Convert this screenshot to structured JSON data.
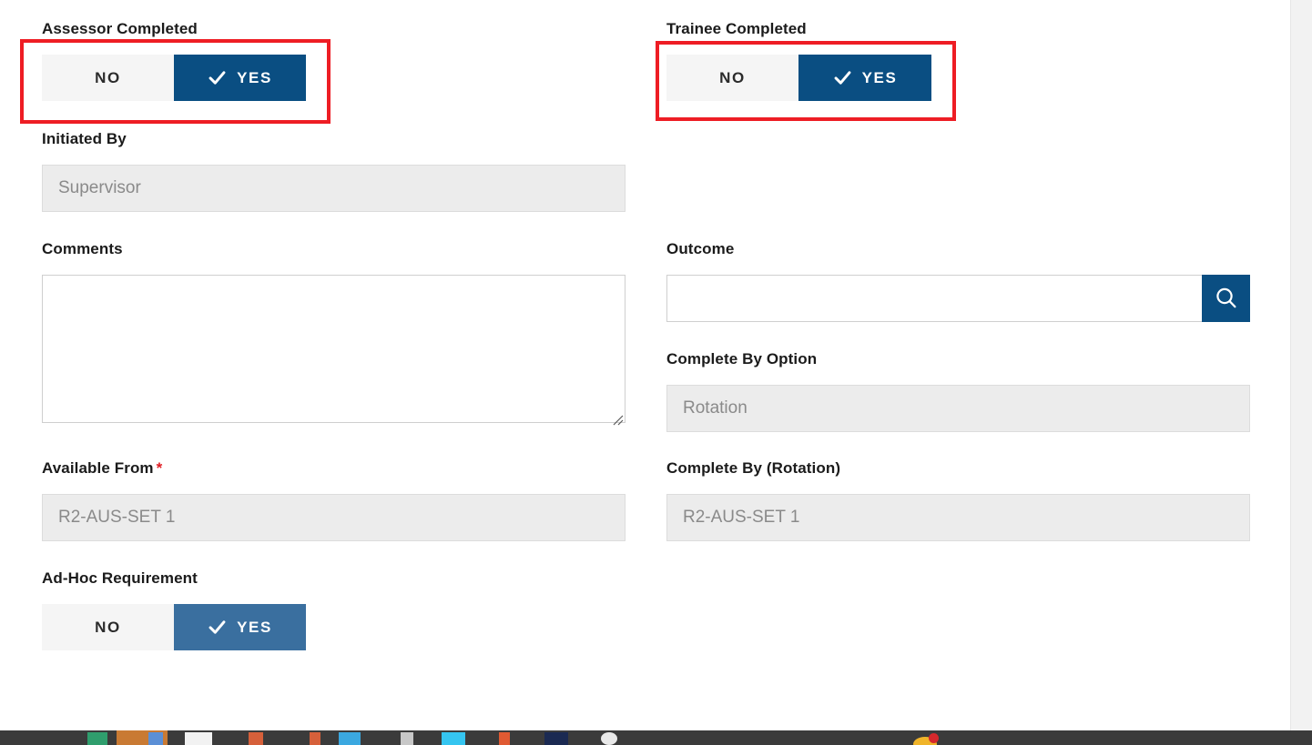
{
  "form": {
    "left_column": [
      {
        "key": "assessor_completed",
        "label": "Assessor Completed",
        "type": "toggle",
        "options": [
          "NO",
          "YES"
        ],
        "selected": "YES",
        "highlighted": true
      },
      {
        "key": "initiated_by",
        "label": "Initiated By",
        "type": "text",
        "value": "Supervisor",
        "disabled": true
      },
      {
        "key": "comments",
        "label": "Comments",
        "type": "textarea",
        "value": "",
        "placeholder": ""
      },
      {
        "key": "available_from",
        "label": "Available From",
        "required": true,
        "required_marker": "*",
        "type": "text",
        "value": "R2-AUS-SET 1",
        "disabled": true
      },
      {
        "key": "ad_hoc_requirement",
        "label": "Ad-Hoc Requirement",
        "type": "toggle",
        "options": [
          "NO",
          "YES"
        ],
        "selected": "YES",
        "muted": true,
        "highlighted": false
      }
    ],
    "right_column": [
      {
        "key": "trainee_completed",
        "label": "Trainee Completed",
        "type": "toggle",
        "options": [
          "NO",
          "YES"
        ],
        "selected": "YES",
        "highlighted": true
      },
      {
        "key": "outcome",
        "label": "Outcome",
        "type": "search",
        "value": "",
        "placeholder": "",
        "button_icon": "search-icon"
      },
      {
        "key": "complete_by_option",
        "label": "Complete By Option",
        "type": "text",
        "value": "Rotation",
        "disabled": true
      },
      {
        "key": "complete_by_rotation",
        "label": "Complete By (Rotation)",
        "type": "text",
        "value": "R2-AUS-SET 1",
        "disabled": true
      }
    ]
  },
  "icons": {
    "check": "check-icon",
    "search": "search-icon",
    "resize_grip": "resize-grip-icon"
  },
  "colors": {
    "primary_blue": "#0a4e82",
    "muted_blue": "#3a6f9f",
    "toggle_off_bg": "#f5f5f5",
    "disabled_input_bg": "#ececec",
    "highlight_red": "#ee1d24",
    "required_red": "#e01b22",
    "label_text": "#1b1b1b",
    "disabled_text": "#8a8a8a",
    "taskbar_bg": "#3b3b3b"
  },
  "labels": {
    "assessor_completed": "Assessor Completed",
    "trainee_completed": "Trainee Completed",
    "initiated_by": "Initiated By",
    "comments": "Comments",
    "outcome": "Outcome",
    "complete_by_option": "Complete By Option",
    "available_from": "Available From",
    "complete_by_rotation": "Complete By (Rotation)",
    "ad_hoc_requirement": "Ad-Hoc Requirement"
  },
  "values": {
    "initiated_by": "Supervisor",
    "comments": "",
    "outcome": "",
    "complete_by_option": "Rotation",
    "available_from": "R2-AUS-SET 1",
    "complete_by_rotation": "R2-AUS-SET 1"
  },
  "toggle_labels": {
    "no": "NO",
    "yes": "YES"
  },
  "misc": {
    "required_marker": "*"
  }
}
